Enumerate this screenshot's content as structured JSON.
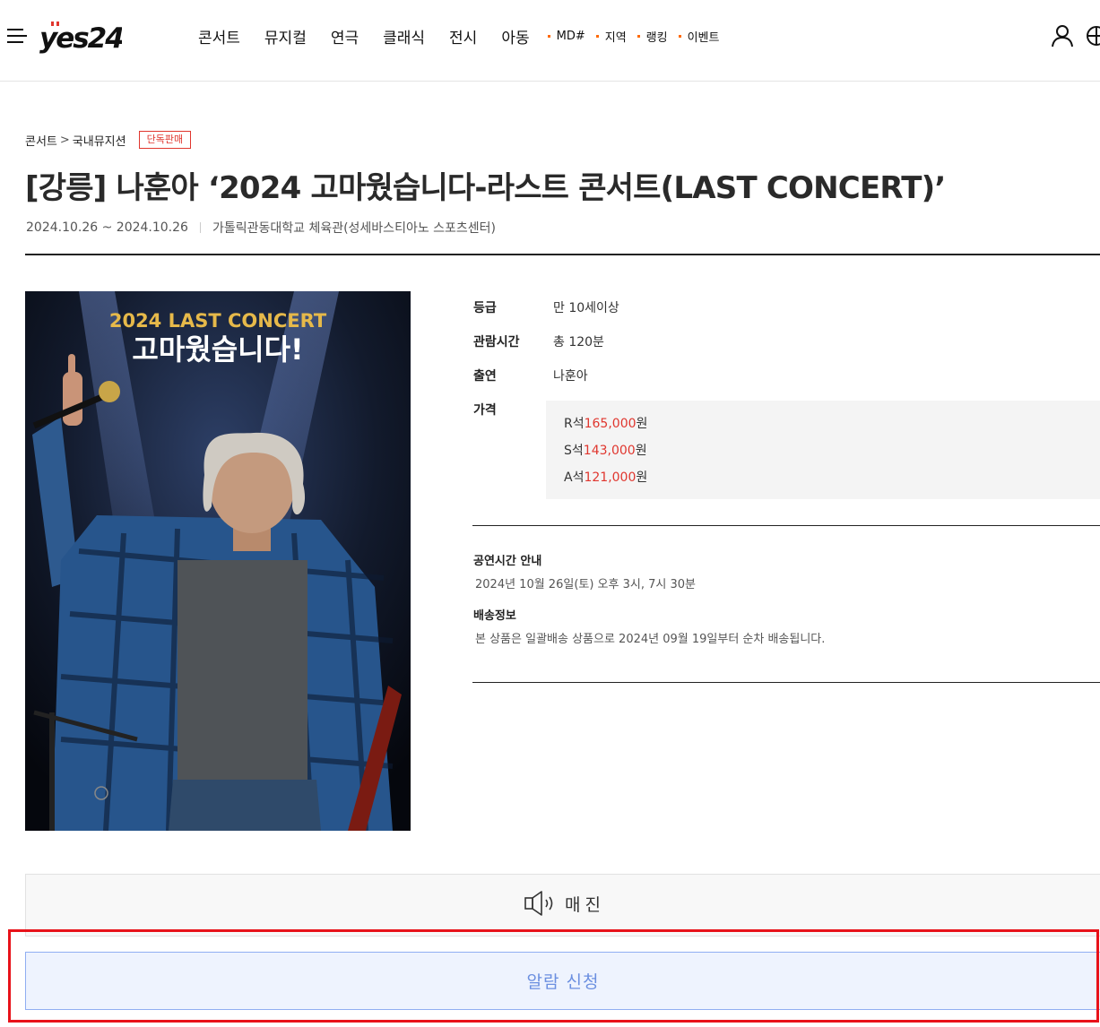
{
  "header": {
    "logo_text": "yes24",
    "main_nav": [
      "콘서트",
      "뮤지컬",
      "연극",
      "클래식",
      "전시",
      "아동"
    ],
    "sub_nav": [
      "MD#",
      "지역",
      "랭킹",
      "이벤트"
    ],
    "accent_color": "#ff6a00",
    "icons": {
      "menu": "hamburger-icon",
      "user": "user-icon",
      "language": "globe-icon"
    }
  },
  "breadcrumb": {
    "category": "콘서트",
    "separator": ">",
    "subcategory": "국내뮤지션",
    "badge": "단독판매"
  },
  "product": {
    "title": "[강릉] 나훈아 ‘2024 고마웠습니다-라스트 콘서트(LAST CONCERT)’",
    "period": "2024.10.26 ~ 2024.10.26",
    "venue": "가톨릭관동대학교 체육관(성세바스티아노 스포츠센터)"
  },
  "poster": {
    "headline": "2024 LAST CONCERT",
    "subtitle": "고마웠습니다!"
  },
  "info": {
    "rating_label": "등급",
    "rating": "만 10세이상",
    "runtime_label": "관람시간",
    "runtime": "총 120분",
    "cast_label": "출연",
    "cast": "나훈아",
    "price_label": "가격",
    "prices": [
      {
        "seat": "R석",
        "amount": "165,000",
        "unit": "원"
      },
      {
        "seat": "S석",
        "amount": "143,000",
        "unit": "원"
      },
      {
        "seat": "A석",
        "amount": "121,000",
        "unit": "원"
      }
    ],
    "price_color": "#e0362e"
  },
  "schedule": {
    "heading": "공연시간 안내",
    "text": "2024년 10월 26일(토) 오후 3시, 7시 30분"
  },
  "delivery": {
    "heading": "배송정보",
    "text": "본 상품은 일괄배송 상품으로 2024년 09월 19일부터 순차 배송됩니다."
  },
  "status": {
    "text": "매진",
    "icon": "speaker-icon"
  },
  "alarm_button": {
    "label": "알람 신청",
    "color": "#6b8fe0"
  },
  "highlight_color": "#e8121a"
}
